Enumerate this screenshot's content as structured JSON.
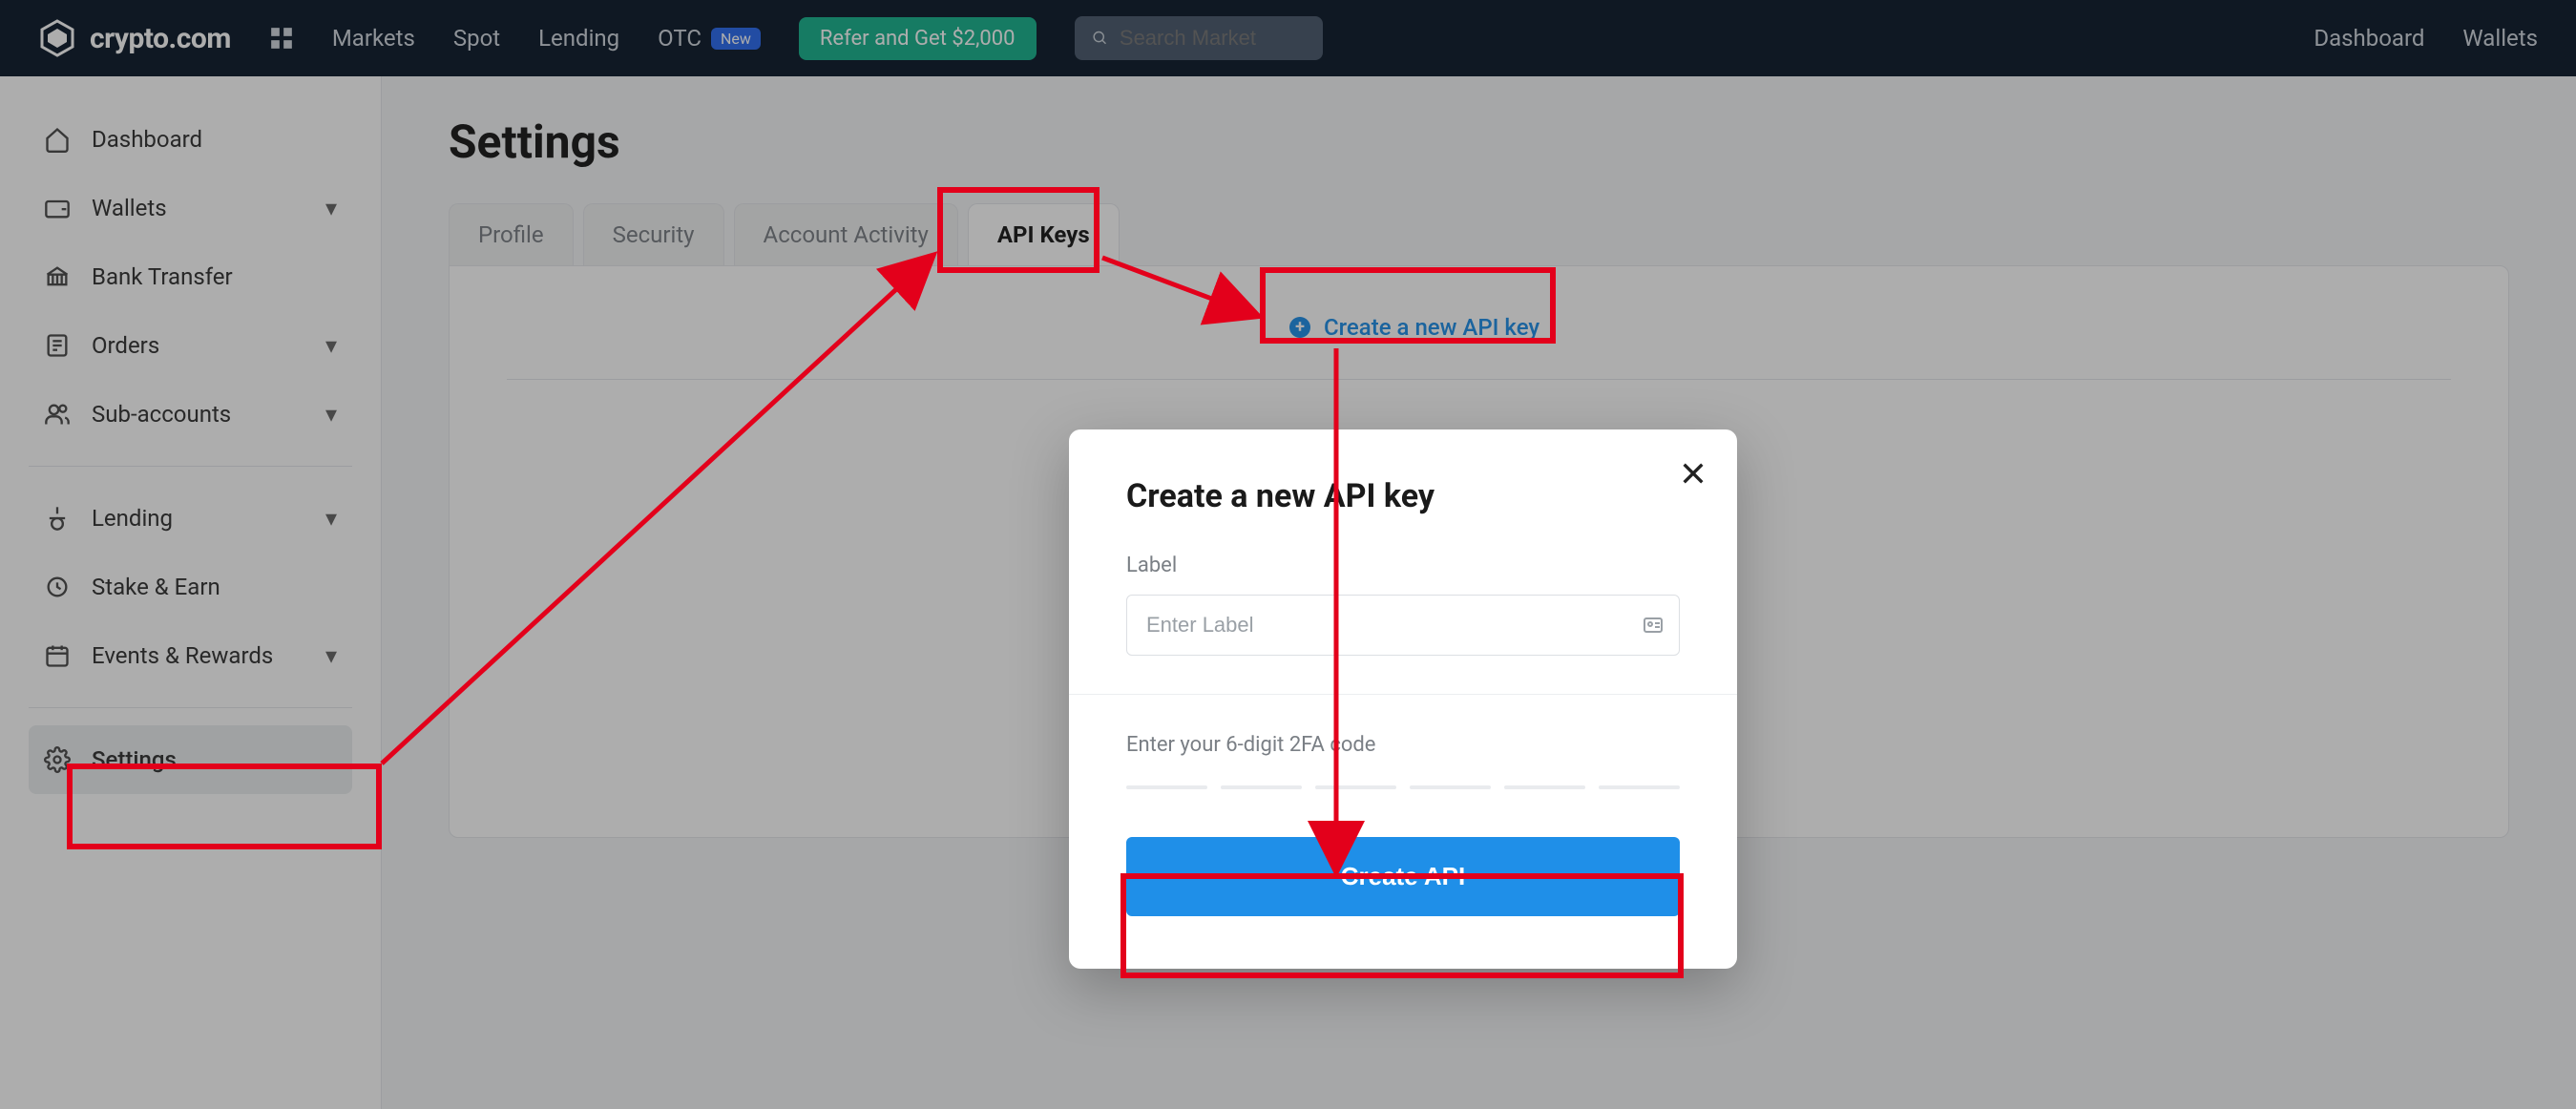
{
  "topnav": {
    "brand": "crypto.com",
    "items": [
      "Markets",
      "Spot",
      "Lending",
      "OTC"
    ],
    "badge_new": "New",
    "refer_label": "Refer and Get $2,000",
    "search_placeholder": "Search Market",
    "right_items": [
      "Dashboard",
      "Wallets"
    ]
  },
  "sidebar": {
    "items": [
      {
        "label": "Dashboard",
        "icon": "home-icon",
        "chevron": false
      },
      {
        "label": "Wallets",
        "icon": "wallet-icon",
        "chevron": true
      },
      {
        "label": "Bank Transfer",
        "icon": "bank-icon",
        "chevron": false
      },
      {
        "label": "Orders",
        "icon": "orders-icon",
        "chevron": true
      },
      {
        "label": "Sub-accounts",
        "icon": "users-icon",
        "chevron": true
      },
      {
        "label": "Lending",
        "icon": "lending-icon",
        "chevron": true
      },
      {
        "label": "Stake & Earn",
        "icon": "stake-icon",
        "chevron": false
      },
      {
        "label": "Events & Rewards",
        "icon": "calendar-icon",
        "chevron": true
      },
      {
        "label": "Settings",
        "icon": "gear-icon",
        "chevron": false,
        "active": true
      }
    ]
  },
  "main": {
    "title": "Settings",
    "tabs": [
      {
        "label": "Profile"
      },
      {
        "label": "Security"
      },
      {
        "label": "Account Activity"
      },
      {
        "label": "API Keys",
        "active": true
      }
    ],
    "create_link": "Create a new API key"
  },
  "modal": {
    "title": "Create a new API key",
    "label_field": "Label",
    "label_placeholder": "Enter Label",
    "tfa_prompt": "Enter your 6-digit 2FA code",
    "submit": "Create API"
  },
  "colors": {
    "accent": "#1f8fe8",
    "nav_bg": "#0d1b2c",
    "refer_bg": "#17b28e",
    "highlight": "#e3001b"
  }
}
